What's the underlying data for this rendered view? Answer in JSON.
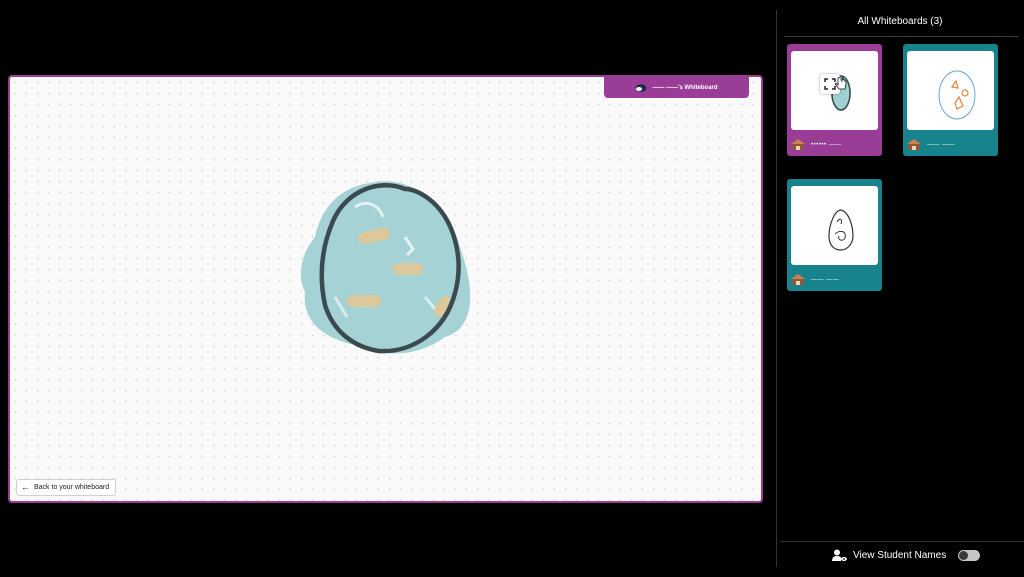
{
  "main_board": {
    "owner_label": "—— ——'s Whiteboard",
    "back_button_label": "Back to your whiteboard",
    "colors": {
      "border": "#9a3d97",
      "egg_fill": "#9fd0d3",
      "egg_outline": "#3b4a4e",
      "spots": "#dcc89a"
    }
  },
  "sidebar": {
    "title": "All Whiteboards (3)",
    "thumbnails": [
      {
        "name": "••••••  ——",
        "frame_color": "#9a3d97",
        "icon": "expand-icon"
      },
      {
        "name": "——  ——",
        "frame_color": "#17838c"
      },
      {
        "name": "——  ——",
        "frame_color": "#17838c"
      }
    ]
  },
  "footer": {
    "toggle_label": "View Student Names",
    "toggle_on": false,
    "icon": "person-eye-icon"
  }
}
